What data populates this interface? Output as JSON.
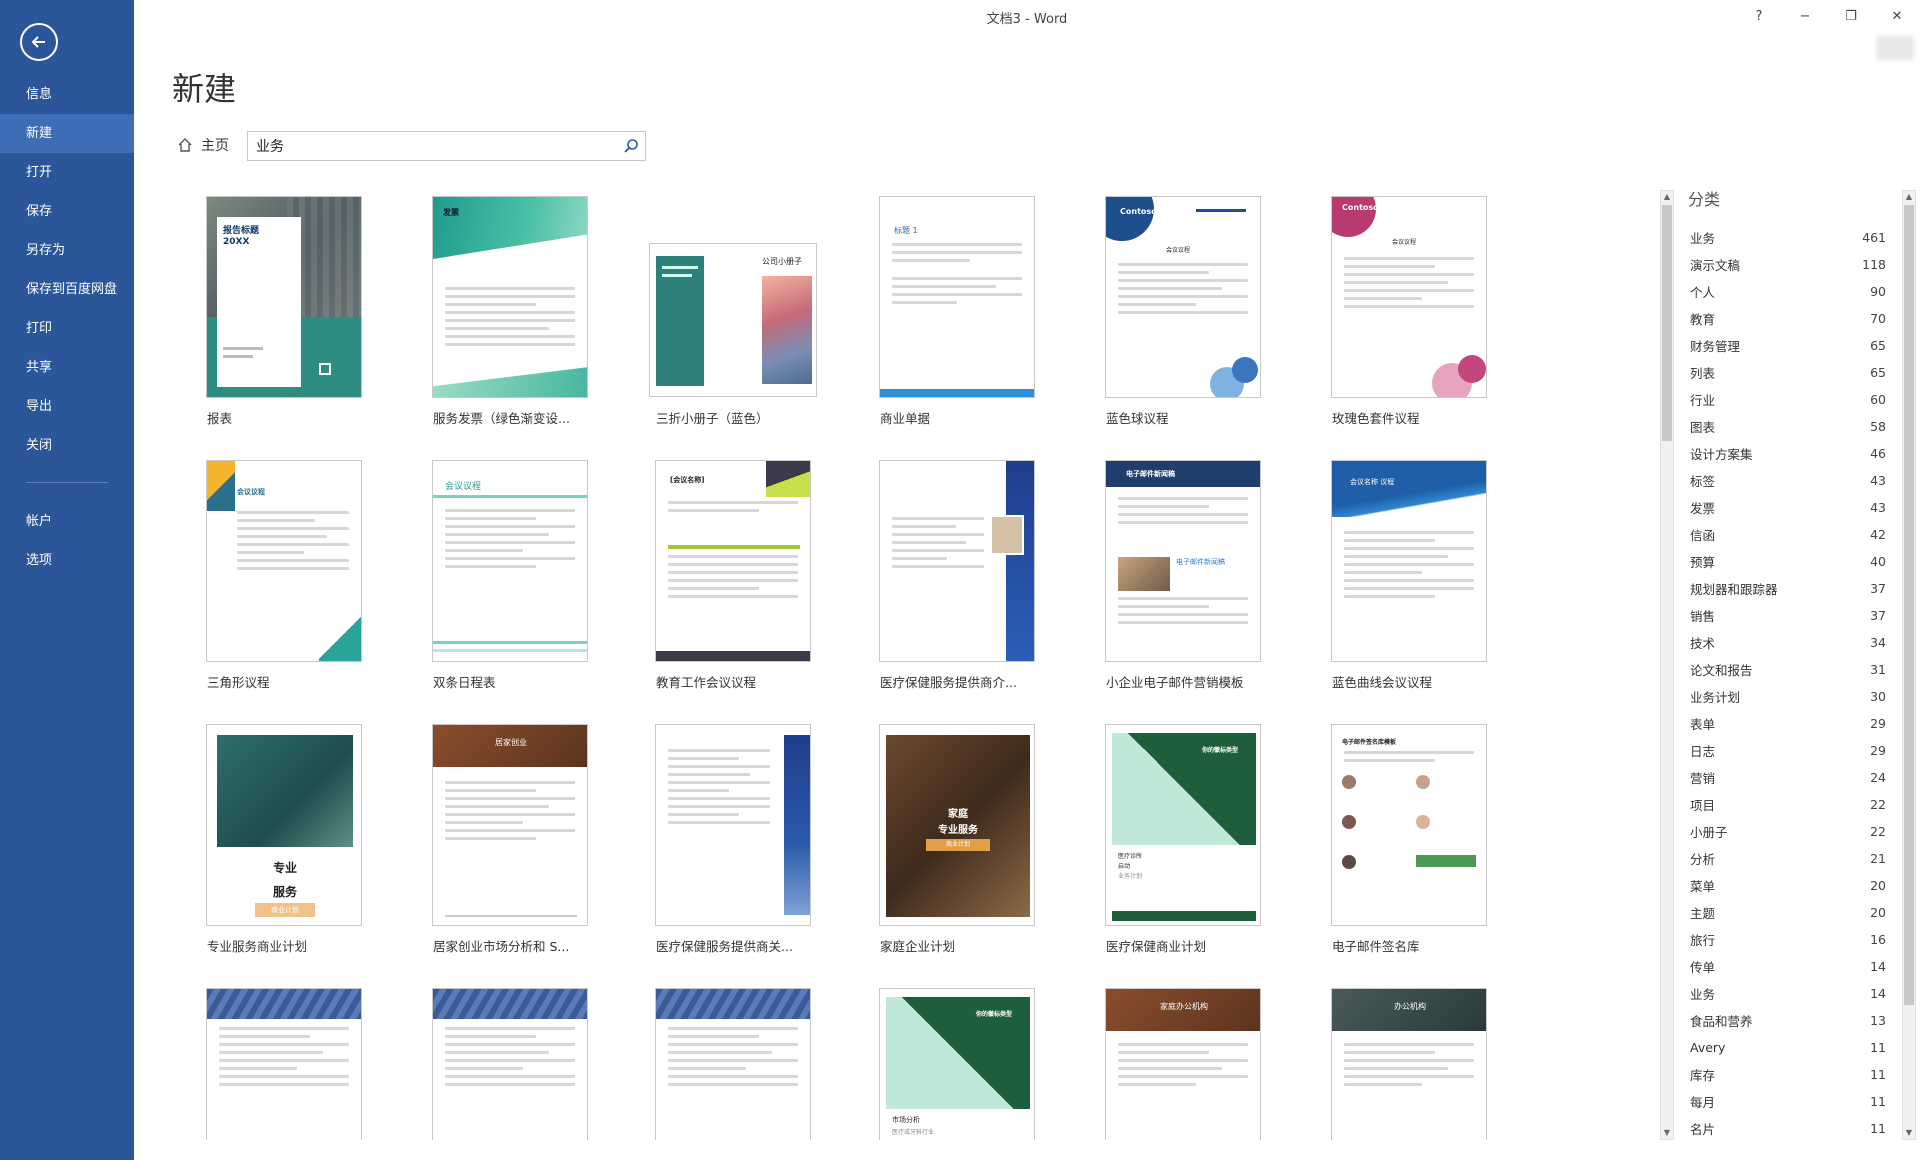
{
  "window": {
    "title": "文档3 - Word",
    "help": "?",
    "minimize": "−",
    "restore": "❐",
    "close": "✕"
  },
  "sidebar": {
    "items": [
      {
        "label": "信息"
      },
      {
        "label": "新建",
        "active": true
      },
      {
        "label": "打开"
      },
      {
        "label": "保存"
      },
      {
        "label": "另存为"
      },
      {
        "label": "保存到百度网盘"
      },
      {
        "label": "打印"
      },
      {
        "label": "共享"
      },
      {
        "label": "导出"
      },
      {
        "label": "关闭"
      }
    ],
    "bottom_items": [
      {
        "label": "帐户"
      },
      {
        "label": "选项"
      }
    ]
  },
  "main": {
    "title": "新建",
    "home_label": "主页",
    "search_value": "业务"
  },
  "templates": [
    {
      "label": "报表"
    },
    {
      "label": "服务发票（绿色渐变设..."
    },
    {
      "label": "三折小册子（蓝色）"
    },
    {
      "label": "商业单据"
    },
    {
      "label": "蓝色球议程"
    },
    {
      "label": "玫瑰色套件议程"
    },
    {
      "label": "三角形议程"
    },
    {
      "label": "双条日程表"
    },
    {
      "label": "教育工作会议议程"
    },
    {
      "label": "医疗保健服务提供商介..."
    },
    {
      "label": "小企业电子邮件营销模板"
    },
    {
      "label": "蓝色曲线会议议程"
    },
    {
      "label": "专业服务商业计划"
    },
    {
      "label": "居家创业市场分析和 S..."
    },
    {
      "label": "医疗保健服务提供商关..."
    },
    {
      "label": "家庭企业计划"
    },
    {
      "label": "医疗保健商业计划"
    },
    {
      "label": "电子邮件签名库"
    },
    {
      "label": ""
    },
    {
      "label": ""
    },
    {
      "label": ""
    },
    {
      "label": ""
    },
    {
      "label": ""
    },
    {
      "label": ""
    }
  ],
  "thumb_text": {
    "report_title": "报告标题",
    "report_year": "20XX",
    "invoice": "发票",
    "brochure": "公司小册子",
    "title1": "标题 1",
    "contoso": "Contoso",
    "meeting_agenda": "会议议程",
    "edu_agenda": "[会议名称]",
    "newsletter": "电子邮件新闻稿",
    "blue_curve": "会议名称 议程",
    "pro_1": "专业",
    "pro_2": "服务",
    "pro_3": "商业计划",
    "home_biz": "居家创业",
    "family_1": "家庭",
    "family_2": "专业服务",
    "family_3": "商业计划",
    "your_logo": "你的徽标类型",
    "clinic": "医疗诊所",
    "startup": "启动",
    "startup_sub": "业务计划",
    "sig_lib": "电子邮件签名库模板",
    "market": "市场分析",
    "market_sub": "医疗或牙科行业",
    "home_office": "家庭办公机构",
    "office": "办公机构"
  },
  "categories": {
    "heading": "分类",
    "items": [
      {
        "name": "业务",
        "count": "461"
      },
      {
        "name": "演示文稿",
        "count": "118"
      },
      {
        "name": "个人",
        "count": "90"
      },
      {
        "name": "教育",
        "count": "70"
      },
      {
        "name": "财务管理",
        "count": "65"
      },
      {
        "name": "列表",
        "count": "65"
      },
      {
        "name": "行业",
        "count": "60"
      },
      {
        "name": "图表",
        "count": "58"
      },
      {
        "name": "设计方案集",
        "count": "46"
      },
      {
        "name": "标签",
        "count": "43"
      },
      {
        "name": "发票",
        "count": "43"
      },
      {
        "name": "信函",
        "count": "42"
      },
      {
        "name": "预算",
        "count": "40"
      },
      {
        "name": "规划器和跟踪器",
        "count": "37"
      },
      {
        "name": "销售",
        "count": "37"
      },
      {
        "name": "技术",
        "count": "34"
      },
      {
        "name": "论文和报告",
        "count": "31"
      },
      {
        "name": "业务计划",
        "count": "30"
      },
      {
        "name": "表单",
        "count": "29"
      },
      {
        "name": "日志",
        "count": "29"
      },
      {
        "name": "营销",
        "count": "24"
      },
      {
        "name": "项目",
        "count": "22"
      },
      {
        "name": "小册子",
        "count": "22"
      },
      {
        "name": "分析",
        "count": "21"
      },
      {
        "name": "菜单",
        "count": "20"
      },
      {
        "name": "主题",
        "count": "20"
      },
      {
        "name": "旅行",
        "count": "16"
      },
      {
        "name": "传单",
        "count": "14"
      },
      {
        "name": "业务",
        "count": "14"
      },
      {
        "name": "食品和营养",
        "count": "13"
      },
      {
        "name": "Avery",
        "count": "11"
      },
      {
        "name": "库存",
        "count": "11"
      },
      {
        "name": "每月",
        "count": "11"
      },
      {
        "name": "名片",
        "count": "11"
      }
    ]
  },
  "colors": {
    "accent": "#2b579a",
    "accent_active": "#3e6db5"
  }
}
